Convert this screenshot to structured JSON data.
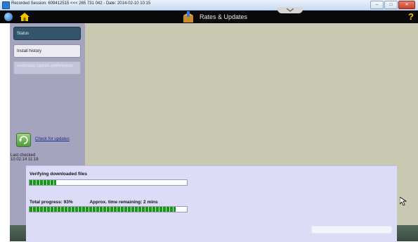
{
  "window": {
    "title": "Recorded Session: 609412515 <<< 265 731 042 - Date: 2014-02-10 10:15",
    "min_label": "–",
    "max_label": "□",
    "close_label": "✕"
  },
  "header": {
    "title": "Rates & Updates",
    "help_label": "?"
  },
  "sidebar": {
    "items": [
      {
        "label": "Status",
        "state": "active"
      },
      {
        "label": "Install history",
        "state": "normal"
      },
      {
        "label": "Automatic update preferences",
        "state": "disabled"
      }
    ],
    "check_updates_label": "Check for updates",
    "last_checked_label": "Last checked",
    "last_checked_value": "10.02.14 11:18"
  },
  "progress": {
    "heading": "Verifying downloaded files",
    "verify_fraction": 0.17,
    "total_label": "Total progress: 93%",
    "approx_label": "Approx. time remaining: 2 mins",
    "total_fraction": 0.93
  },
  "colors": {
    "header_bg": "#0a0a0a",
    "sidebar_bg": "#a4a4bf",
    "main_bg": "#c9c8b1",
    "panel_bg": "#dcdcf8",
    "progress_green": "#169a16",
    "active_item": "#33546a"
  },
  "icons": {
    "back": "globe-back-icon",
    "home": "home-icon",
    "title": "package-icon",
    "help": "help-icon",
    "refresh": "refresh-icon"
  }
}
